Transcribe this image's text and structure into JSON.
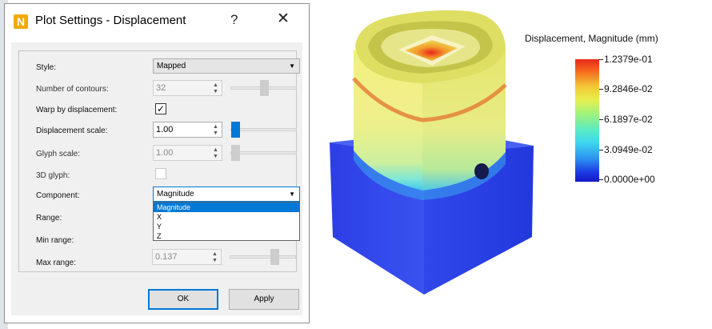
{
  "dialog": {
    "app_icon": "N",
    "title": "Plot Settings - Displacement",
    "help_label": "?",
    "close_label": "✕"
  },
  "form": {
    "style": {
      "label": "Style:",
      "value": "Mapped"
    },
    "contours": {
      "label": "Number of contours:",
      "value": "32",
      "slider_fraction": 0.5
    },
    "warp": {
      "label": "Warp by displacement:",
      "checked": true,
      "mark": "✓"
    },
    "disp_scale": {
      "label": "Displacement scale:",
      "value": "1.00",
      "slider_fraction": 0.0
    },
    "glyph_scale": {
      "label": "Glyph scale:",
      "value": "1.00",
      "slider_fraction": 0.0
    },
    "glyph3d": {
      "label": "3D glyph:",
      "checked": false
    },
    "component": {
      "label": "Component:",
      "value": "Magnitude",
      "options": [
        "Magnitude",
        "X",
        "Y",
        "Z"
      ]
    },
    "range": {
      "label": "Range:"
    },
    "min_range": {
      "label": "Min range:"
    },
    "max_range": {
      "label": "Max range:",
      "value": "0.137",
      "slider_fraction": 0.7
    }
  },
  "buttons": {
    "ok": "OK",
    "apply": "Apply"
  },
  "legend": {
    "title": "Displacement, Magnitude (mm)",
    "ticks": [
      "1.2379e-01",
      "9.2846e-02",
      "6.1897e-02",
      "3.0949e-02",
      "0.0000e+00"
    ]
  },
  "colors": {
    "accent": "#0078d7",
    "high": "#e8261b",
    "low": "#1419c6"
  },
  "icons": [
    "app-logo-icon",
    "help-icon",
    "close-icon",
    "dropdown-arrow-icon",
    "spin-up-icon",
    "spin-down-icon",
    "checkmark-icon"
  ]
}
